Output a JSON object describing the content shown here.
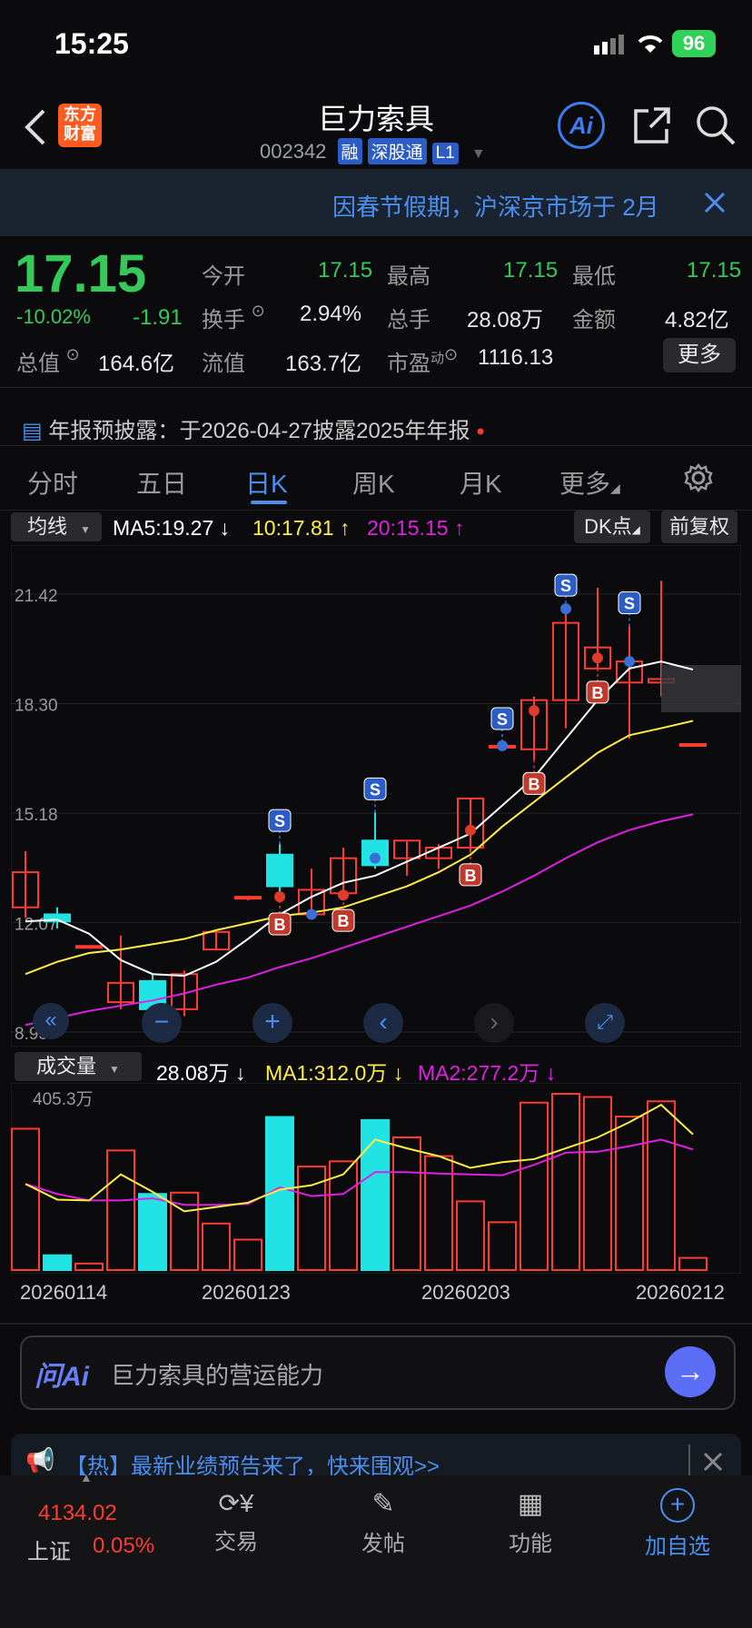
{
  "status_bar": {
    "time": "15:25",
    "battery": "96"
  },
  "header": {
    "brand_logo": "东方\n财富",
    "title": "巨力索具",
    "code": "002342",
    "tags": [
      "融",
      "深股通",
      "L1"
    ],
    "ai_label": "Ai"
  },
  "notice": {
    "text": "因春节假期，沪深京市场于 2月"
  },
  "quote": {
    "price": "17.15",
    "change_pct": "-10.02%",
    "change": "-1.91",
    "fields": [
      {
        "label": "今开",
        "value": "17.15"
      },
      {
        "label": "最高",
        "value": "17.15"
      },
      {
        "label": "最低",
        "value": "17.15"
      },
      {
        "label": "换手",
        "value": "2.94%"
      },
      {
        "label": "总手",
        "value": "28.08万"
      },
      {
        "label": "金额",
        "value": "4.82亿"
      },
      {
        "label": "总值",
        "value": "164.6亿"
      },
      {
        "label": "流值",
        "value": "163.7亿"
      },
      {
        "label": "市盈",
        "sup": "动",
        "value": "1116.13"
      }
    ],
    "more_button": "更多"
  },
  "disclosure": {
    "text": "年报预披露：于2026-04-27披露2025年年报"
  },
  "tabs": [
    "分时",
    "五日",
    "日K",
    "周K",
    "月K",
    "更多"
  ],
  "active_tab": 2,
  "ma_bar": {
    "selector": "均线",
    "ma5": "MA5:19.27",
    "ma10": "10:17.81",
    "ma20": "20:15.15",
    "dk_button": "DK点",
    "adjust_button": "前复权"
  },
  "colors": {
    "up": "#ff3b30",
    "down": "#22e3e3",
    "ma5": "#ffffff",
    "ma10": "#ffee44",
    "ma20": "#e020e0",
    "accent": "#4a8ff0"
  },
  "chart_data": {
    "type": "candlestick",
    "ylim": [
      8.95,
      22.4
    ],
    "y_ticks": [
      "21.42",
      "18.30",
      "15.18",
      "12.07",
      "8.95"
    ],
    "candles": [
      {
        "o": 12.5,
        "c": 13.5,
        "h": 14.1,
        "l": 12.2
      },
      {
        "o": 12.3,
        "c": 12.1,
        "h": 12.5,
        "l": 11.9
      },
      {
        "o": 11.4,
        "c": 11.4,
        "h": 11.4,
        "l": 11.4
      },
      {
        "o": 9.8,
        "c": 10.35,
        "h": 11.7,
        "l": 9.6
      },
      {
        "o": 10.4,
        "c": 9.6,
        "h": 10.6,
        "l": 9.1
      },
      {
        "o": 9.6,
        "c": 10.6,
        "h": 10.7,
        "l": 9.4
      },
      {
        "o": 11.3,
        "c": 11.8,
        "h": 11.8,
        "l": 11.3
      },
      {
        "o": 12.8,
        "c": 12.8,
        "h": 12.8,
        "l": 12.7
      },
      {
        "o": 14.0,
        "c": 13.1,
        "h": 14.3,
        "l": 12.7
      },
      {
        "o": 12.3,
        "c": 13.0,
        "h": 13.6,
        "l": 12.2
      },
      {
        "o": 12.9,
        "c": 13.9,
        "h": 14.2,
        "l": 12.8
      },
      {
        "o": 14.4,
        "c": 13.7,
        "h": 15.2,
        "l": 13.6
      },
      {
        "o": 13.9,
        "c": 14.4,
        "h": 14.4,
        "l": 13.4
      },
      {
        "o": 13.9,
        "c": 14.2,
        "h": 14.3,
        "l": 13.6
      },
      {
        "o": 14.2,
        "c": 15.6,
        "h": 15.6,
        "l": 14.1
      },
      {
        "o": 17.1,
        "c": 17.1,
        "h": 17.2,
        "l": 17.0
      },
      {
        "o": 17.0,
        "c": 18.4,
        "h": 18.5,
        "l": 16.7
      },
      {
        "o": 18.4,
        "c": 20.6,
        "h": 21.0,
        "l": 17.6
      },
      {
        "o": 19.3,
        "c": 19.9,
        "h": 21.6,
        "l": 19.3
      },
      {
        "o": 18.9,
        "c": 19.5,
        "h": 20.5,
        "l": 17.3
      },
      {
        "o": 18.9,
        "c": 19.0,
        "h": 21.8,
        "l": 18.5
      },
      {
        "o": 17.15,
        "c": 17.15,
        "h": 17.15,
        "l": 17.15
      }
    ],
    "ma5": [
      12.1,
      12.15,
      11.75,
      11.0,
      10.6,
      10.55,
      10.95,
      11.6,
      12.3,
      12.8,
      13.2,
      13.4,
      13.8,
      14.2,
      14.6,
      15.4,
      16.2,
      17.3,
      18.4,
      19.3,
      19.5,
      19.27
    ],
    "ma10": [
      10.6,
      10.95,
      11.2,
      11.3,
      11.45,
      11.6,
      11.85,
      12.05,
      12.25,
      12.35,
      12.5,
      12.8,
      13.1,
      13.5,
      14.0,
      14.8,
      15.5,
      16.2,
      16.9,
      17.4,
      17.6,
      17.81
    ],
    "ma20": [
      9.15,
      9.35,
      9.55,
      9.7,
      9.85,
      10.05,
      10.3,
      10.5,
      10.8,
      11.05,
      11.35,
      11.65,
      11.95,
      12.25,
      12.55,
      12.95,
      13.4,
      13.9,
      14.35,
      14.7,
      14.95,
      15.15
    ],
    "signals": [
      {
        "i": 8,
        "t": "B"
      },
      {
        "i": 8,
        "t": "S"
      },
      {
        "i": 10,
        "t": "B"
      },
      {
        "i": 11,
        "t": "S"
      },
      {
        "i": 14,
        "t": "B"
      },
      {
        "i": 15,
        "t": "S"
      },
      {
        "i": 16,
        "t": "B"
      },
      {
        "i": 17,
        "t": "S"
      },
      {
        "i": 18,
        "t": "B"
      },
      {
        "i": 19,
        "t": "S"
      }
    ],
    "dots": [
      {
        "i": 8,
        "v": 12.8,
        "c": "red"
      },
      {
        "i": 9,
        "v": 12.3,
        "c": "blue"
      },
      {
        "i": 10,
        "v": 12.85,
        "c": "red"
      },
      {
        "i": 11,
        "v": 13.9,
        "c": "blue"
      },
      {
        "i": 14,
        "v": 14.7,
        "c": "red"
      },
      {
        "i": 15,
        "v": 17.1,
        "c": "blue"
      },
      {
        "i": 16,
        "v": 18.1,
        "c": "red"
      },
      {
        "i": 17,
        "v": 21.0,
        "c": "blue"
      },
      {
        "i": 18,
        "v": 19.6,
        "c": "red"
      },
      {
        "i": 19,
        "v": 19.5,
        "c": "blue"
      }
    ]
  },
  "volume_bar": {
    "selector": "成交量",
    "vol": "28.08万",
    "ma1": "MA1:312.0万",
    "ma2": "MA2:277.2万",
    "top_label": "405.3万"
  },
  "volume_data": {
    "ylim": [
      0,
      405.3
    ],
    "values": [
      325,
      34,
      15,
      275,
      175,
      178,
      107,
      70,
      352,
      238,
      250,
      345,
      305,
      262,
      158,
      110,
      385,
      405.3,
      398,
      353,
      388,
      28.08
    ],
    "ma1": [
      198,
      162,
      160,
      220,
      180,
      135,
      145,
      155,
      185,
      195,
      220,
      300,
      280,
      262,
      235,
      248,
      255,
      280,
      305,
      340,
      380,
      312
    ],
    "ma2": [
      198,
      175,
      160,
      160,
      165,
      150,
      150,
      152,
      190,
      170,
      175,
      225,
      225,
      222,
      220,
      218,
      242,
      270,
      272,
      285,
      300,
      277.2
    ]
  },
  "x_dates": [
    "20260114",
    "20260123",
    "20260203",
    "20260212"
  ],
  "ai_bar": {
    "brand": "问Ai",
    "placeholder": "巨力索具的营运能力"
  },
  "promo": {
    "text": "【热】最新业绩预告来了，快来围观>>"
  },
  "bottom_nav": {
    "index_value": "4134.02",
    "index_name": "上证",
    "index_change": "0.05%",
    "items": [
      "交易",
      "发帖",
      "功能",
      "加自选"
    ]
  }
}
